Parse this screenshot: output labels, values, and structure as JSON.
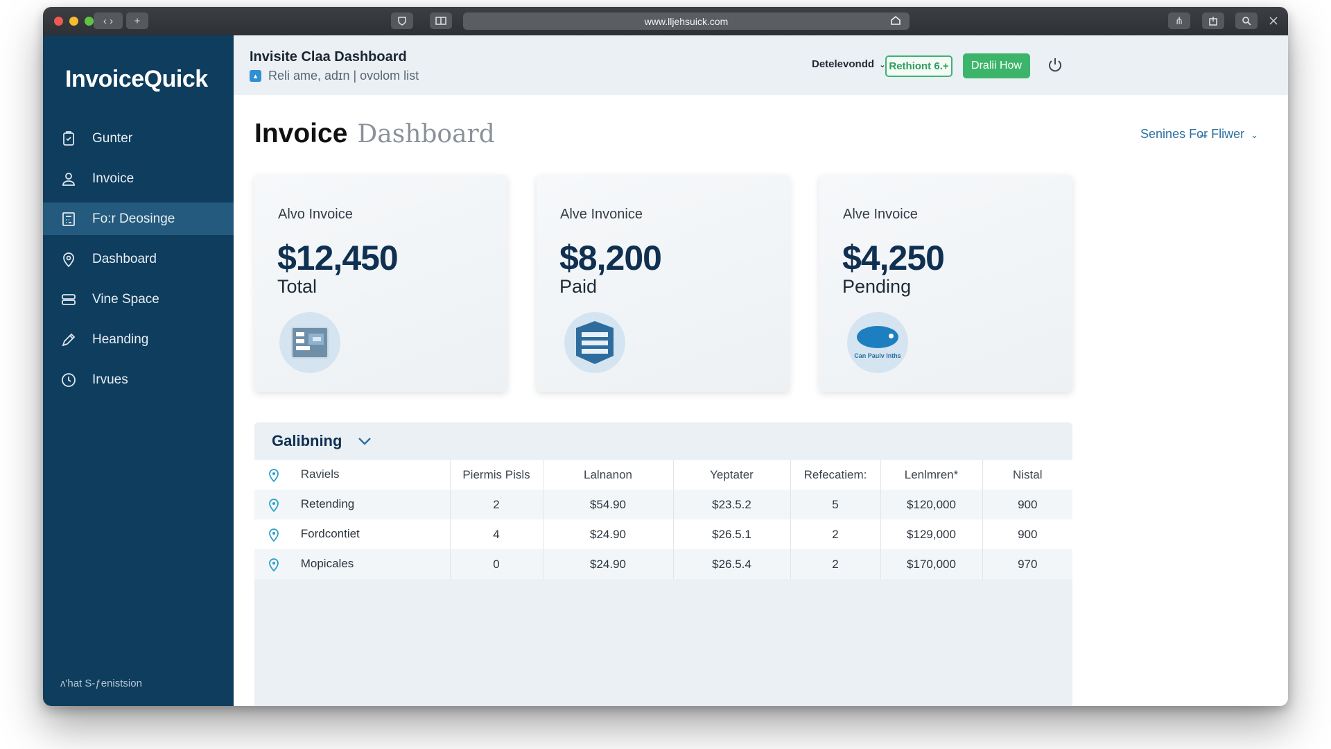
{
  "browser": {
    "url": "www.lljehsuick.com"
  },
  "sidebar": {
    "logo": "InvoiceQuick",
    "items": [
      {
        "label": "Gunter",
        "icon": "clipboard-icon"
      },
      {
        "label": "Invoice",
        "icon": "user-icon"
      },
      {
        "label": "Fo:r Deosinge",
        "icon": "calculator-icon"
      },
      {
        "label": "Dashboard",
        "icon": "location-pin-icon"
      },
      {
        "label": "Vine Space",
        "icon": "storage-icon"
      },
      {
        "label": "Heanding",
        "icon": "pencil-icon"
      },
      {
        "label": "Irvues",
        "icon": "clock-icon"
      }
    ],
    "active_index": 2,
    "footer": "ʌ'hat S-ƒenistsion"
  },
  "header": {
    "title": "Invisite Claa Dashboard",
    "subtitle": "Reli ame, adɪn | ovolom list",
    "select_label": "Detelevondd",
    "outline_button": "Rethiont 6.+",
    "primary_button": "Dralii How"
  },
  "main": {
    "title_bold": "Invoice",
    "title_light": "Dashboard",
    "filter_label": "Senines Fo̶r Fliwer"
  },
  "cards": [
    {
      "label": "Alvo Invoice",
      "value": "$12,450",
      "sub": "Total",
      "icon": "invoice-document-icon"
    },
    {
      "label": "Alve Invonice",
      "value": "$8,200",
      "sub": "Paid",
      "icon": "stacked-documents-icon"
    },
    {
      "label": "Alve Invoice",
      "value": "$4,250",
      "sub": "Pending",
      "icon": "message-bubble-icon",
      "icon_caption": "Can Paulv Inths"
    }
  ],
  "table": {
    "title": "Galibning",
    "columns": [
      "Raviels",
      "Piermis Pisls",
      "Lalnanon",
      "Yeptater",
      "Refecatiem:",
      "Lenlmren*",
      "Nistal"
    ],
    "rows": [
      [
        "Retending",
        "2",
        "$54.90",
        "$23.5.2",
        "5",
        "$120,000",
        "900"
      ],
      [
        "Fordcontiet",
        "4",
        "$24.90",
        "$26.5.1",
        "2",
        "$129,000",
        "900"
      ],
      [
        "Mopicales",
        "0",
        "$24.90",
        "$26.5.4",
        "2",
        "$170,000",
        "970"
      ]
    ]
  },
  "colors": {
    "sidebar": "#0f3d5e",
    "sidebar_active": "#245a7d",
    "accent_green": "#3cb56a",
    "accent_blue": "#2f8fd4",
    "value_text": "#0f3050"
  }
}
